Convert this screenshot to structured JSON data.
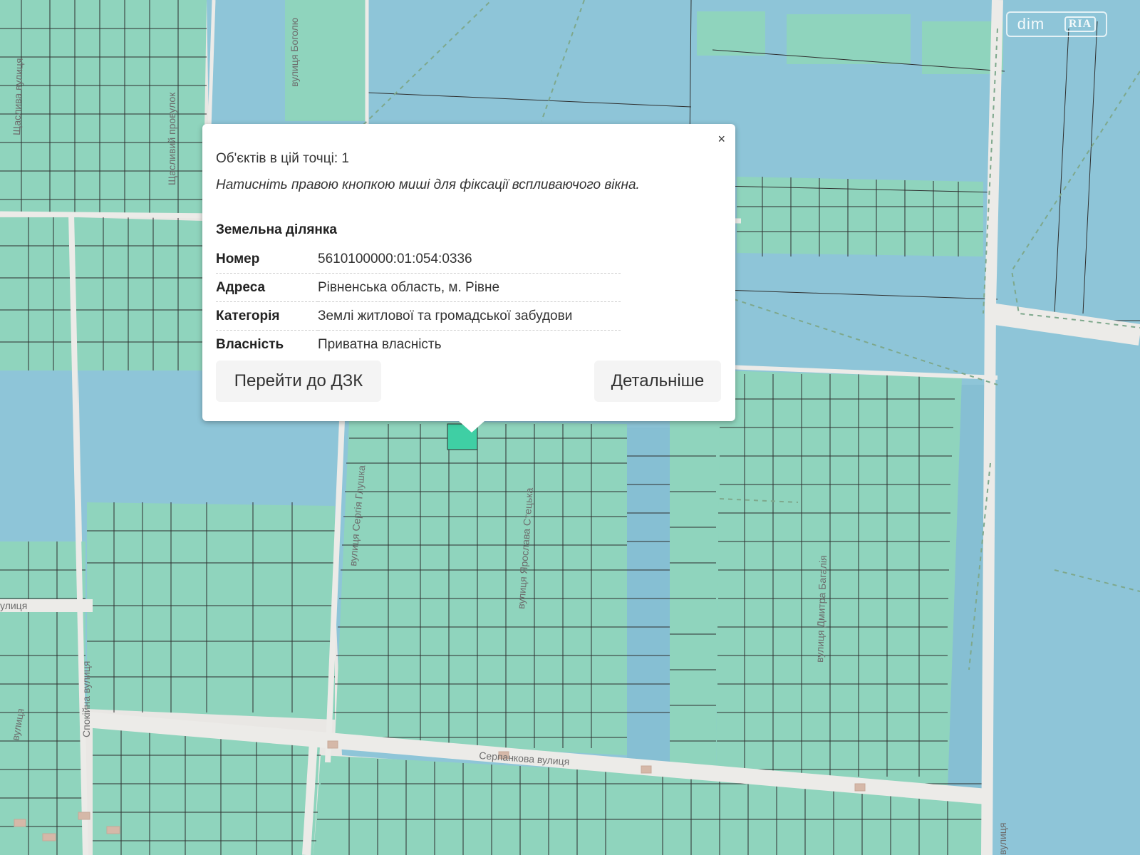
{
  "map": {
    "colors": {
      "private": "#8fd4bd",
      "state": "#8ec5d8",
      "road": "#e9e7e4",
      "selected": "#3fcfa4",
      "parcel_line": "#2e2e2e"
    },
    "street_labels": {
      "serpankova": "Серпанкова вулиця",
      "yaroslava": "вулиця Ярослава Стецька",
      "sergiya": "вулиця Сергія Глушка",
      "dmytra": "вулиця Дмитра Багалія",
      "bogolyu": "вулиця Боголю",
      "shchaslyvyi": "Щасливий провулок",
      "shchaslyva": "Щаслива вулиця",
      "spokiina": "Спокійна вулиця",
      "left_lytsia": "улиця",
      "left_vulytsia": "вулиця",
      "right_vulytsia": "вулиця"
    }
  },
  "watermark": {
    "dim": "dim",
    "ria": "RIA"
  },
  "popup": {
    "objects_count": "Об'єктів в цій точці: 1",
    "hint": "Натисніть правою кнопкою миші для фіксації вспливаючого вікна.",
    "close_label": "×",
    "section_title": "Земельна ділянка",
    "rows": [
      {
        "key": "Номер",
        "value": "5610100000:01:054:0336"
      },
      {
        "key": "Адреса",
        "value": "Рівненська область, м. Рівне"
      },
      {
        "key": "Категорія",
        "value": "Землі житлової та громадської забудови"
      },
      {
        "key": "Власність",
        "value": "Приватна власність"
      }
    ],
    "btn_dzk": "Перейти до ДЗК",
    "btn_details": "Детальніше"
  }
}
